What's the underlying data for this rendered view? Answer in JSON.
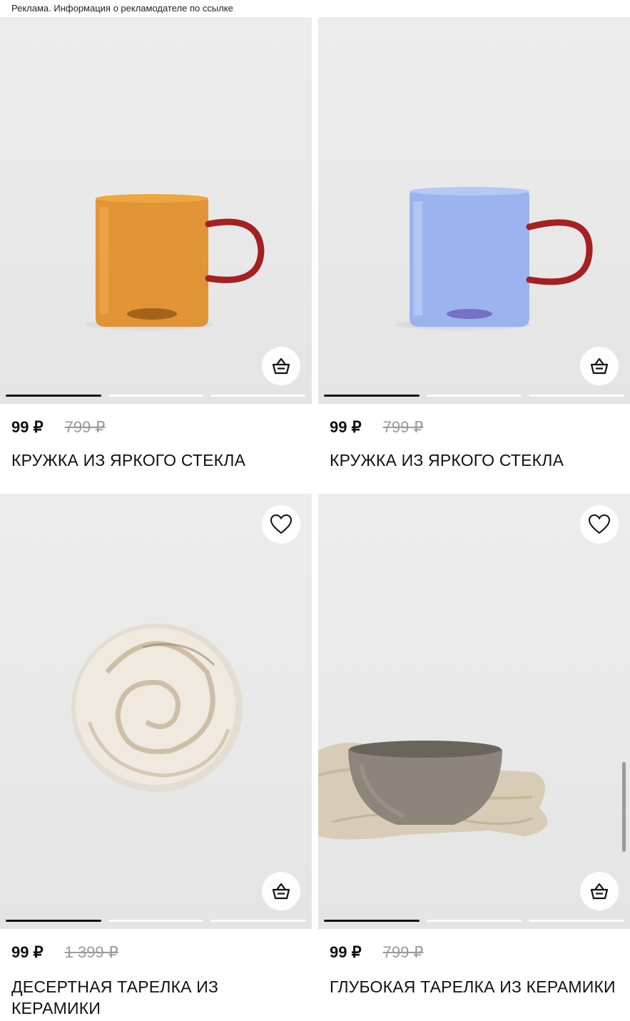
{
  "ad_notice": "Реклама. Информация о рекламодателе по ссылке",
  "colors": {
    "accent": "#111111",
    "old_price": "#9a9a9a",
    "photo_bg": "#ececec"
  },
  "products": [
    {
      "price": "99 ₽",
      "old_price": "799 ₽",
      "title": "КРУЖКА ИЗ ЯРКОГО СТЕКЛА",
      "image": "orange-glass-mug",
      "icons": [
        "basket-icon"
      ],
      "gallery_index": 1
    },
    {
      "price": "99 ₽",
      "old_price": "799 ₽",
      "title": "КРУЖКА ИЗ ЯРКОГО СТЕКЛА",
      "image": "blue-glass-mug",
      "icons": [
        "basket-icon"
      ],
      "gallery_index": 1
    },
    {
      "price": "99 ₽",
      "old_price": "1 399 ₽",
      "title": "ДЕСЕРТНАЯ ТАРЕЛКА ИЗ КЕРАМИКИ",
      "image": "marble-dessert-plate",
      "icons": [
        "heart-icon",
        "basket-icon"
      ],
      "gallery_index": 1
    },
    {
      "price": "99 ₽",
      "old_price": "799 ₽",
      "title": "ГЛУБОКАЯ ТАРЕЛКА ИЗ КЕРАМИКИ",
      "image": "grey-ceramic-bowl",
      "icons": [
        "heart-icon",
        "basket-icon"
      ],
      "gallery_index": 1
    }
  ]
}
